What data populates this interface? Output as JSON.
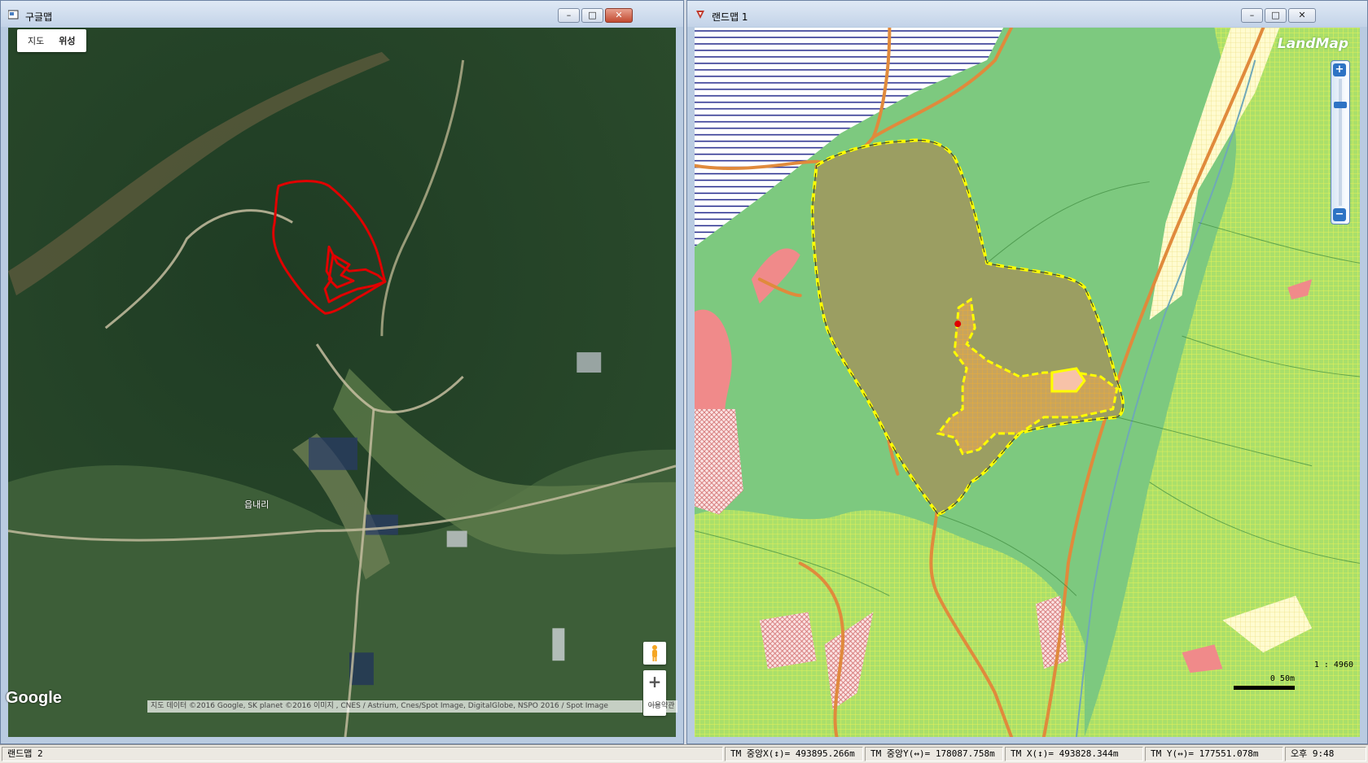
{
  "google_window": {
    "title": "구글맵",
    "map_types": [
      "지도",
      "위성"
    ],
    "place_label": "읍내리",
    "logo": "Google",
    "attribution": "지도 데이터 ©2016 Google, SK planet ©2016 이미지 , CNES / Astrium, Cnes/Spot Image, DigitalGlobe, NSPO 2016 / Spot Image",
    "terms": "이용약관",
    "zoom_in": "+",
    "zoom_out": "−"
  },
  "land_window": {
    "title": "랜드맵 1",
    "logo": "LandMap",
    "zoom_in": "+",
    "zoom_out": "−",
    "scale_ratio": "1 : 4960",
    "scale_distance": "0   50m"
  },
  "window_controls": {
    "minimize": "–",
    "maximize": "□",
    "close": "✕"
  },
  "statusbar": {
    "app_name": "랜드맵 2",
    "tm_center_x": "TM 중앙X(↕)= 493895.266m",
    "tm_center_y": "TM 중앙Y(↔)= 178087.758m",
    "tm_x": "TM X(↕)= 493828.344m",
    "tm_y": "TM Y(↔)= 177551.078m",
    "clock": "오후 9:48"
  },
  "colors": {
    "parcel_outline": "#e00000",
    "land_green": "#7dc97f",
    "parcel_fill": "#9b9e62",
    "highlight": "#ffff00",
    "road": "#e08a3c",
    "pink_zone": "#f08a8a"
  }
}
